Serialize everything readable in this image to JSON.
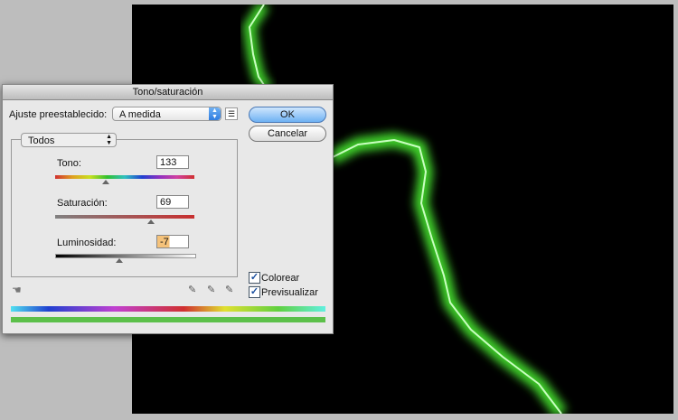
{
  "dialog": {
    "title": "Tono/saturación",
    "preset_label": "Ajuste preestablecido:",
    "preset_value": "A medida",
    "ok": "OK",
    "cancel": "Cancelar",
    "channel": "Todos",
    "hue": {
      "label": "Tono:",
      "value": "133"
    },
    "saturation": {
      "label": "Saturación:",
      "value": "69"
    },
    "lightness": {
      "label": "Luminosidad:",
      "value": "-7"
    },
    "colorize": {
      "label": "Colorear",
      "checked": true
    },
    "preview": {
      "label": "Previsualizar",
      "checked": true
    }
  },
  "colors": {
    "canvas": "#000000",
    "glow": "#6cff5a",
    "result_bar": "#5cc04a"
  }
}
